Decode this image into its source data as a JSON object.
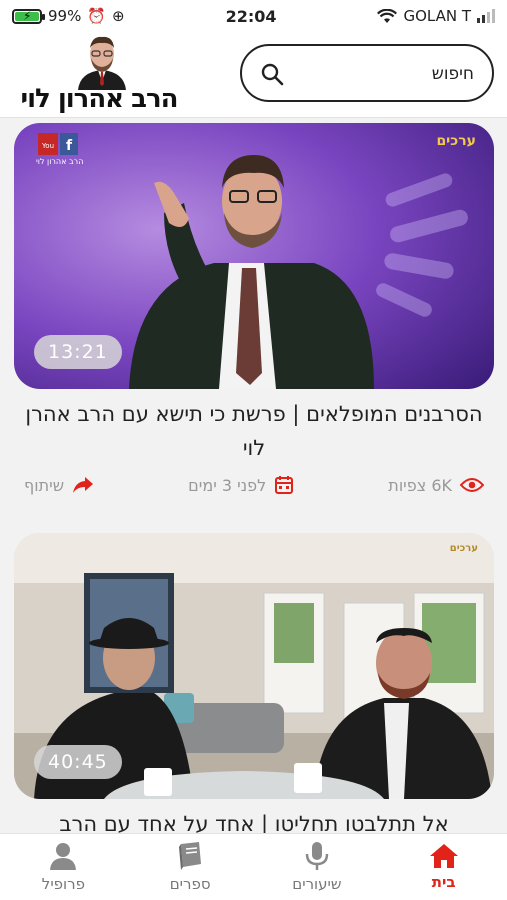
{
  "status_bar": {
    "battery": "99%",
    "time": "22:04",
    "carrier": "GOLAN T"
  },
  "header": {
    "logo_text": "הרב אהרון לוי",
    "search": {
      "placeholder": "חיפוש"
    }
  },
  "feed": [
    {
      "duration": "13:21",
      "title": "הסרבנים המופלאים | פרשת כי תישא עם הרב אהרן לוי",
      "views": "6K צפיות",
      "date": "לפני 3 ימים",
      "share": "שיתוף",
      "thumb_logo": "ערכים",
      "thumb_social": "הרב אהרון לוי"
    },
    {
      "duration": "40:45",
      "title": "אל תתלבטו תחליטו | אחד על אחד עם הרב",
      "thumb_logo": "ערכים"
    }
  ],
  "nav": {
    "tabs": [
      {
        "label": "בית",
        "icon": "home-icon",
        "active": true
      },
      {
        "label": "שיעורים",
        "icon": "microphone-icon",
        "active": false
      },
      {
        "label": "ספרים",
        "icon": "book-icon",
        "active": false
      },
      {
        "label": "פרופיל",
        "icon": "user-icon",
        "active": false
      }
    ]
  },
  "colors": {
    "accent": "#e2231a",
    "muted": "#999999"
  }
}
